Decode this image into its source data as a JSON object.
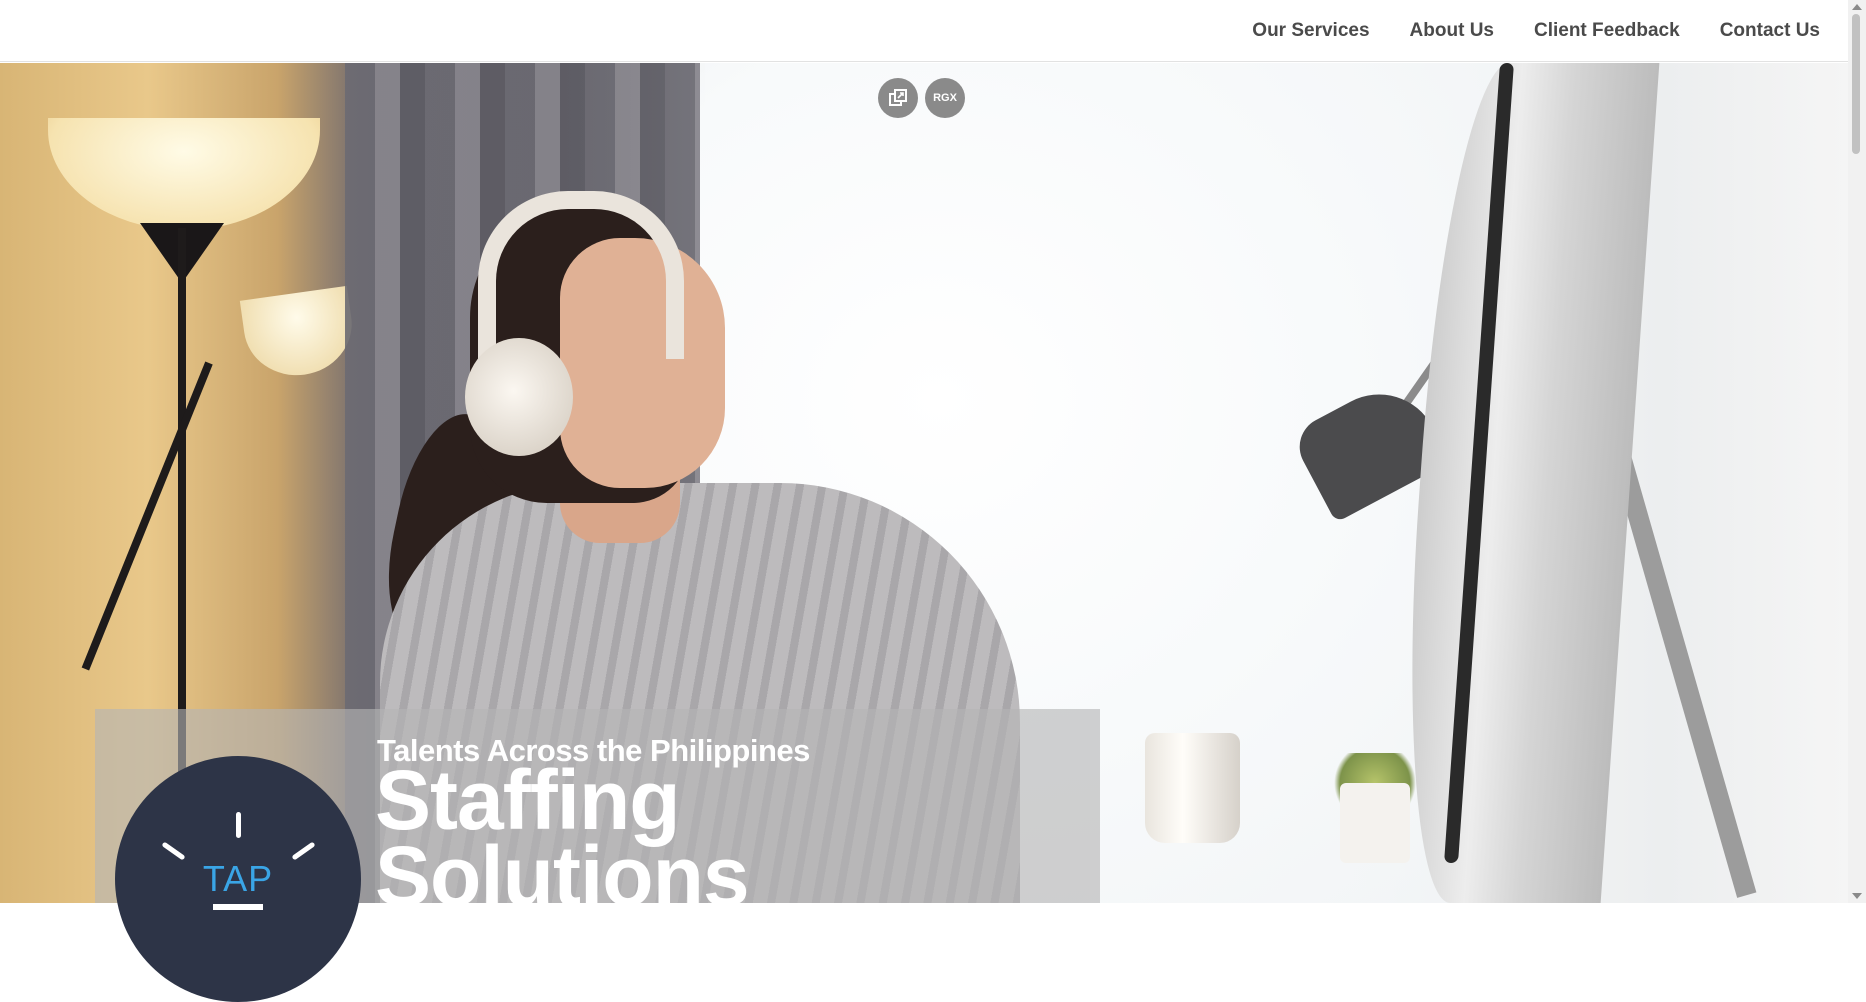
{
  "nav": {
    "links": [
      {
        "label": "Our Services"
      },
      {
        "label": "About Us"
      },
      {
        "label": "Client Feedback"
      },
      {
        "label": "Contact Us"
      }
    ]
  },
  "floating_buttons": {
    "rgx_label": "RGX"
  },
  "hero": {
    "tagline": "Talents Across the Philippines",
    "headline_line1": "Staffing",
    "headline_line2": "Solutions"
  },
  "logo": {
    "text": "TAP",
    "text_color": "#3aa5e6",
    "circle_color": "#2d3447"
  }
}
